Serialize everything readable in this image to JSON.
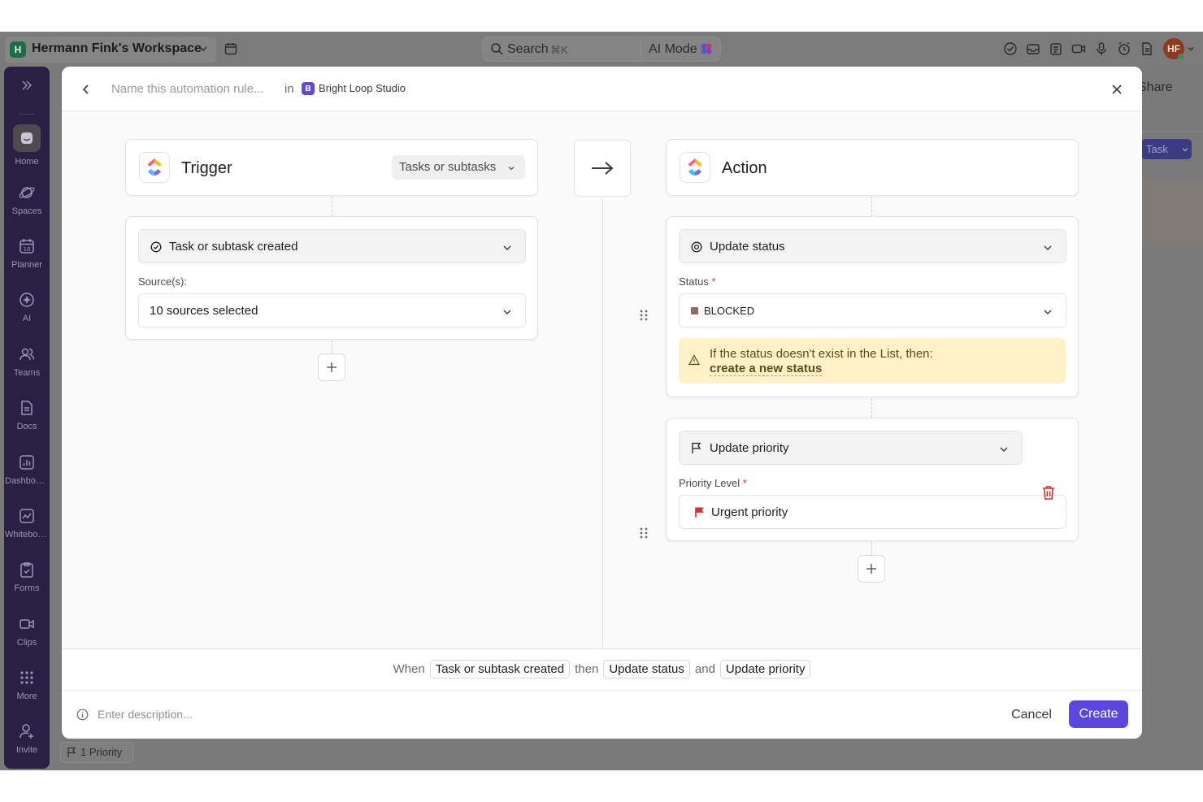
{
  "topbar": {
    "workspace_badge": "H",
    "workspace_name": "Hermann Fink's Workspace",
    "search_label": "Search",
    "search_shortcut": "⌘K",
    "ai_mode_label": "AI Mode",
    "avatar_initials": "HF"
  },
  "sidebar": {
    "items": [
      {
        "label": "Home",
        "icon": "home-icon"
      },
      {
        "label": "Spaces",
        "icon": "planet-icon"
      },
      {
        "label": "Planner",
        "icon": "calendar-icon"
      },
      {
        "label": "AI",
        "icon": "ai-icon"
      },
      {
        "label": "Teams",
        "icon": "teams-icon"
      },
      {
        "label": "Docs",
        "icon": "doc-icon"
      },
      {
        "label": "Dashboards",
        "icon": "dashboard-icon"
      },
      {
        "label": "Whiteboards",
        "icon": "whiteboard-icon"
      },
      {
        "label": "Forms",
        "icon": "form-icon"
      },
      {
        "label": "Clips",
        "icon": "video-icon"
      },
      {
        "label": "More",
        "icon": "grid-icon"
      },
      {
        "label": "Invite",
        "icon": "invite-icon"
      }
    ]
  },
  "background": {
    "share_label": "Share",
    "task_button_label": "Task",
    "priority_chip_label": "1 Priority"
  },
  "modal": {
    "name_placeholder": "Name this automation rule...",
    "in_label": "in",
    "space_badge": "B",
    "space_name": "Bright Loop Studio",
    "trigger": {
      "title": "Trigger",
      "scope": "Tasks or subtasks",
      "event": "Task or subtask created",
      "sources_label": "Source(s):",
      "sources_value": "10 sources selected"
    },
    "action": {
      "title": "Action",
      "step1": {
        "label": "Update status",
        "field_label": "Status",
        "required_mark": "*",
        "field_value": "BLOCKED",
        "status_color": "#8a6e67",
        "warning_text": "If the status doesn't exist in the List, then:",
        "warning_link": "create a new status"
      },
      "step2": {
        "label": "Update priority",
        "field_label": "Priority Level",
        "required_mark": "*",
        "field_value": "Urgent priority",
        "flag_color": "#d32f2f"
      }
    },
    "summary": {
      "when": "When",
      "trigger_chip": "Task or subtask created",
      "then": "then",
      "action1_chip": "Update status",
      "and": "and",
      "action2_chip": "Update priority"
    },
    "footer": {
      "description_placeholder": "Enter description...",
      "cancel_label": "Cancel",
      "create_label": "Create"
    }
  },
  "colors": {
    "accent": "#5b47e0",
    "sidebar": "#2a2046",
    "warning_bg": "#fdf2c7",
    "danger": "#d32f2f"
  }
}
